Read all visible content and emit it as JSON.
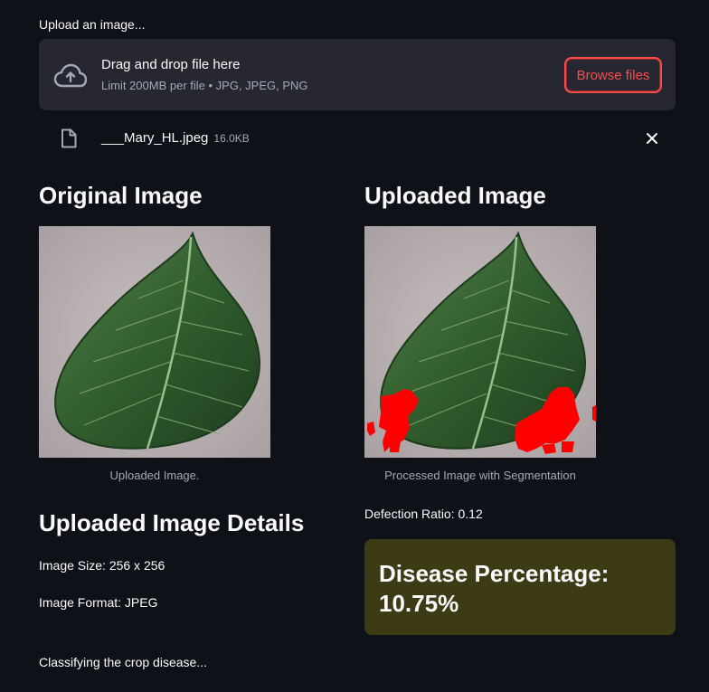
{
  "uploader": {
    "label": "Upload an image...",
    "drop_title": "Drag and drop file here",
    "drop_subtitle": "Limit 200MB per file • JPG, JPEG, PNG",
    "browse_label": "Browse files",
    "file_name": "___Mary_HL.jpeg",
    "file_size": "16.0KB"
  },
  "original": {
    "heading": "Original Image",
    "caption": "Uploaded Image."
  },
  "processed": {
    "heading": "Uploaded Image",
    "caption": "Processed Image with Segmentation",
    "defection_ratio": "Defection Ratio: 0.12",
    "disease_line1": "Disease Percentage:",
    "disease_line2": "10.75%"
  },
  "details": {
    "heading": "Uploaded Image Details",
    "size": "Image Size: 256 x 256",
    "format": "Image Format: JPEG"
  },
  "status": "Classifying the crop disease...",
  "colors": {
    "background": "#0e1117",
    "panel": "#262730",
    "accent": "#ff4b4b",
    "warning_box": "#3d3b16",
    "segmentation": "#ff0000"
  }
}
